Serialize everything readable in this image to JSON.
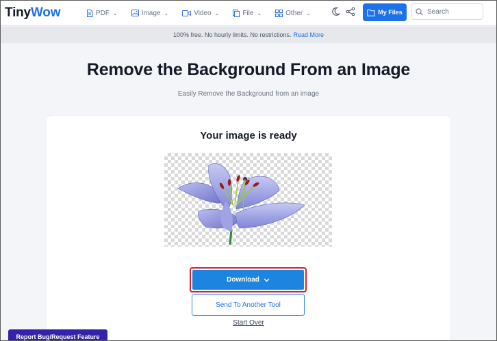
{
  "logo": {
    "part1": "Tiny",
    "part2": "Wow"
  },
  "nav": [
    {
      "label": "PDF",
      "icon": "pdf-icon"
    },
    {
      "label": "Image",
      "icon": "image-icon"
    },
    {
      "label": "Video",
      "icon": "video-icon"
    },
    {
      "label": "File",
      "icon": "file-icon"
    },
    {
      "label": "Other",
      "icon": "grid-icon"
    }
  ],
  "header": {
    "my_files_label": "My Files",
    "search_placeholder": "Search"
  },
  "banner": {
    "text": "100% free. No hourly limits. No restrictions.",
    "link": "Read More"
  },
  "hero": {
    "title": "Remove the Background From an Image",
    "subtitle": "Easily Remove the Background from an image"
  },
  "result": {
    "title": "Your image is ready",
    "download_label": "Download",
    "send_label": "Send To Another Tool",
    "start_over_label": "Start Over"
  },
  "report": {
    "label": "Report Bug/Request Feature"
  },
  "colors": {
    "brand_blue": "#1d72e8",
    "highlight_red": "#d61f2c",
    "report_purple": "#3422a8"
  }
}
